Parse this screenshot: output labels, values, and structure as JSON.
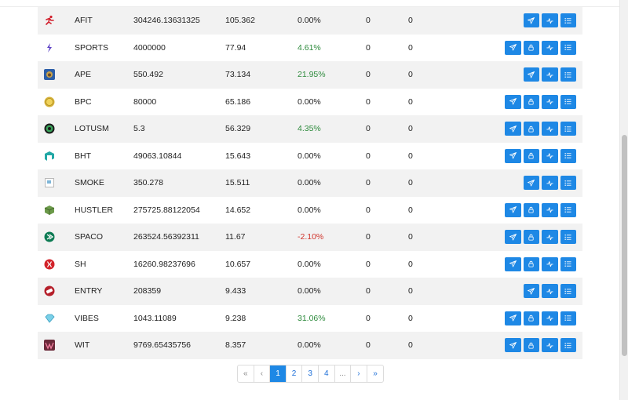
{
  "rows": [
    {
      "symbol": "AFIT",
      "balance": "304246.13631325",
      "value": "105.362",
      "change": "0.00%",
      "dir": "",
      "col_a": "0",
      "col_b": "0",
      "icon": "afit-runner-icon",
      "stake": false
    },
    {
      "symbol": "SPORTS",
      "balance": "4000000",
      "value": "77.94",
      "change": "4.61%",
      "dir": "pos",
      "col_a": "0",
      "col_b": "0",
      "icon": "sports-bolt-icon",
      "stake": true
    },
    {
      "symbol": "APE",
      "balance": "550.492",
      "value": "73.134",
      "change": "21.95%",
      "dir": "pos",
      "col_a": "0",
      "col_b": "0",
      "icon": "ape-token-icon",
      "stake": false
    },
    {
      "symbol": "BPC",
      "balance": "80000",
      "value": "65.186",
      "change": "0.00%",
      "dir": "",
      "col_a": "0",
      "col_b": "0",
      "icon": "bpc-coin-icon",
      "stake": true
    },
    {
      "symbol": "LOTUSM",
      "balance": "5.3",
      "value": "56.329",
      "change": "4.35%",
      "dir": "pos",
      "col_a": "0",
      "col_b": "0",
      "icon": "lotusm-token-icon",
      "stake": true
    },
    {
      "symbol": "BHT",
      "balance": "49063.10844",
      "value": "15.643",
      "change": "0.00%",
      "dir": "",
      "col_a": "0",
      "col_b": "0",
      "icon": "bht-token-icon",
      "stake": true
    },
    {
      "symbol": "SMOKE",
      "balance": "350.278",
      "value": "15.511",
      "change": "0.00%",
      "dir": "",
      "col_a": "0",
      "col_b": "0",
      "icon": "broken-image-icon",
      "stake": false
    },
    {
      "symbol": "HUSTLER",
      "balance": "275725.88122054",
      "value": "14.652",
      "change": "0.00%",
      "dir": "",
      "col_a": "0",
      "col_b": "0",
      "icon": "hustler-cube-icon",
      "stake": true
    },
    {
      "symbol": "SPACO",
      "balance": "263524.56392311",
      "value": "11.67",
      "change": "-2.10%",
      "dir": "neg",
      "col_a": "0",
      "col_b": "0",
      "icon": "spaco-token-icon",
      "stake": true
    },
    {
      "symbol": "SH",
      "balance": "16260.98237696",
      "value": "10.657",
      "change": "0.00%",
      "dir": "",
      "col_a": "0",
      "col_b": "0",
      "icon": "sh-hive-icon",
      "stake": true
    },
    {
      "symbol": "ENTRY",
      "balance": "208359",
      "value": "9.433",
      "change": "0.00%",
      "dir": "",
      "col_a": "0",
      "col_b": "0",
      "icon": "entry-ticket-icon",
      "stake": false
    },
    {
      "symbol": "VIBES",
      "balance": "1043.11089",
      "value": "9.238",
      "change": "31.06%",
      "dir": "pos",
      "col_a": "0",
      "col_b": "0",
      "icon": "vibes-gem-icon",
      "stake": true
    },
    {
      "symbol": "WIT",
      "balance": "9769.65435756",
      "value": "8.357",
      "change": "0.00%",
      "dir": "",
      "col_a": "0",
      "col_b": "0",
      "icon": "wit-token-icon",
      "stake": true
    }
  ],
  "actions": {
    "transfer_icon": "paper-plane-icon",
    "stake_icon": "lock-icon",
    "chart_icon": "activity-chart-icon",
    "list_icon": "list-icon"
  },
  "pagination": {
    "first": "«",
    "prev": "‹",
    "pages": [
      "1",
      "2",
      "3",
      "4"
    ],
    "current": "1",
    "ellipsis": "...",
    "next": "›",
    "last": "»"
  },
  "colors": {
    "primary": "#1e88e5",
    "positive": "#2e8b3d",
    "negative": "#d0342c",
    "row_stripe": "#f2f2f2"
  }
}
